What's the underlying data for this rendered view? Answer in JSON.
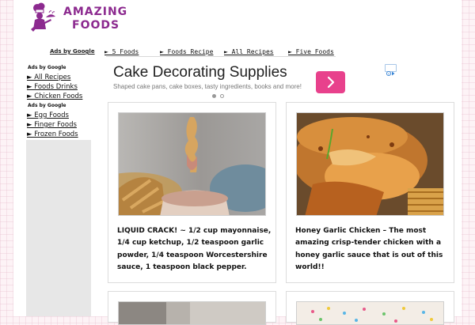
{
  "brand": {
    "line1": "AMAZING",
    "line2": "FOODS",
    "color": "#8c2a8f"
  },
  "topnav": {
    "ads_label": "Ads by Google",
    "links": [
      "► 5 Foods",
      "► Foods Recipe",
      "► All Recipes",
      "► Five Foods"
    ]
  },
  "sidebar": {
    "ads_label_1": "Ads by Google",
    "group1": [
      "► All Recipes",
      "► Foods Drinks",
      "► Chicken Foods"
    ],
    "ads_label_2": "Ads by Google",
    "group2": [
      "► Egg Foods",
      "► Finger Foods",
      "► Frozen Foods"
    ]
  },
  "ad": {
    "title": "Cake Decorating Supplies",
    "description": "Shaped cake pans, cake boxes, tasty ingredients, books and more!",
    "button_color": "#e8418c",
    "arrow_icon": "chevron-right-icon",
    "choices_icon": "adchoices-icon",
    "carousel_active": 0
  },
  "cards": [
    {
      "text": "LIQUID CRACK! ~ 1/2 cup mayonnaise, 1/4 cup ketchup, 1/2 teaspoon garlic powder, 1/4 teaspoon Worcestershire sauce, 1 teaspoon black pepper.",
      "image": "fries-with-dipping-sauce"
    },
    {
      "text": "Honey Garlic Chicken – The most amazing crisp-tender chicken with a honey garlic sauce that is out of this world!!",
      "image": "honey-garlic-chicken"
    },
    {
      "text": "",
      "image": "partial-food-photo"
    },
    {
      "text": "",
      "image": "partial-sprinkle-dessert"
    }
  ]
}
